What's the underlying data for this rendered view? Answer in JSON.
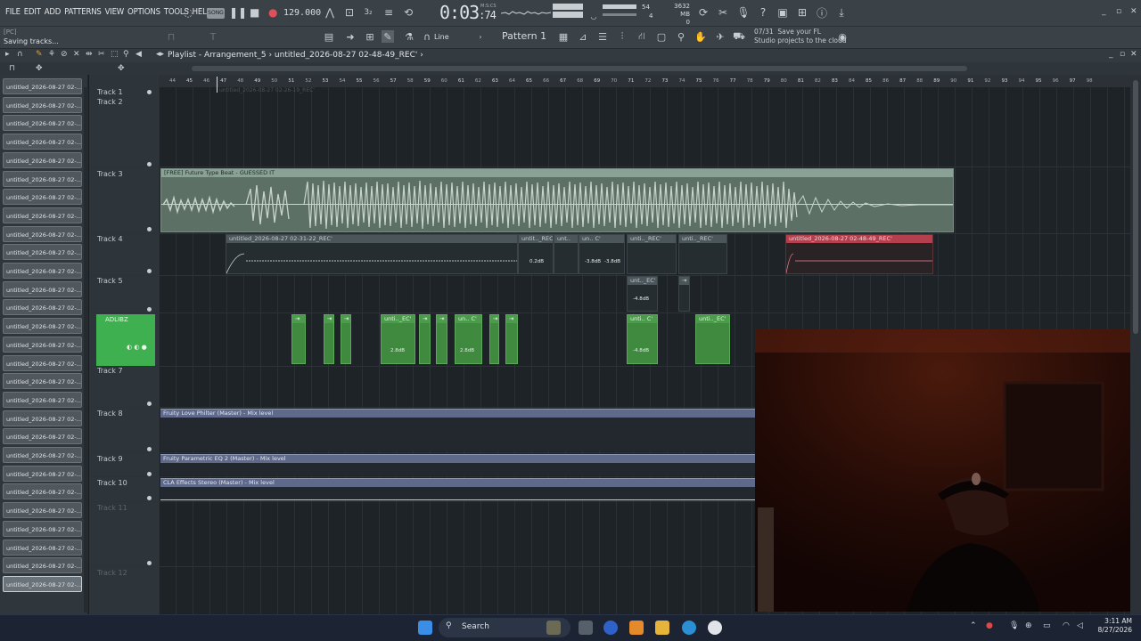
{
  "menu": [
    "FILE",
    "EDIT",
    "ADD",
    "PATTERNS",
    "VIEW",
    "OPTIONS",
    "TOOLS",
    "HELP"
  ],
  "transport": {
    "mode": "SONG",
    "tempo": "129.000",
    "time": "0:03",
    "time_sub": ":74",
    "time_format": "M:S:CS",
    "cpu_mem": "3632 MB",
    "cpu_num": "0",
    "poly_top": "54",
    "poly_bottom": "4"
  },
  "status": {
    "hint_target": "[PC]",
    "hint_text": "Saving tracks..."
  },
  "toolbar2": {
    "snap": "Line",
    "pattern": "Pattern 1"
  },
  "news": {
    "line1_prefix": "07/31",
    "line1": "Save your FL",
    "line2": "Studio projects to the cloud"
  },
  "playlist": {
    "title": "Playlist - Arrangement_5",
    "current_clip": "untitled_2026-08-27 02-48-49_REC'"
  },
  "picker_items": [
    "untitled_2026-08-27 02-...",
    "untitled_2026-08-27 02-...",
    "untitled_2026-08-27 02-...",
    "untitled_2026-08-27 02-...",
    "untitled_2026-08-27 02-...",
    "untitled_2026-08-27 02-...",
    "untitled_2026-08-27 02-...",
    "untitled_2026-08-27 02-...",
    "untitled_2026-08-27 02-...",
    "untitled_2026-08-27 02-...",
    "untitled_2026-08-27 02-...",
    "untitled_2026-08-27 02-...",
    "untitled_2026-08-27 02-...",
    "untitled_2026-08-27 02-...",
    "untitled_2026-08-27 02-...",
    "untitled_2026-08-27 02-...",
    "untitled_2026-08-27 02-...",
    "untitled_2026-08-27 02-...",
    "untitled_2026-08-27 02-...",
    "untitled_2026-08-27 02-...",
    "untitled_2026-08-27 02-...",
    "untitled_2026-08-27 02-...",
    "untitled_2026-08-27 02-...",
    "untitled_2026-08-27 02-...",
    "untitled_2026-08-27 02-...",
    "untitled_2026-08-27 02-...",
    "untitled_2026-08-27 02-...",
    "untitled_2026-08-27 02-..."
  ],
  "tracks": {
    "t1": "Track 1",
    "t2": "Track 2",
    "t3": "Track 3",
    "t4": "Track 4",
    "t5": "Track 5",
    "t6": "ADLIBZ",
    "t7": "Track 7",
    "t8": "Track 8",
    "t9": "Track 9",
    "t10": "Track 10",
    "t11": "Track 11",
    "t12": "Track 12"
  },
  "ruler": [
    "44",
    "45",
    "46",
    "47",
    "48",
    "49",
    "50",
    "51",
    "52",
    "53",
    "54",
    "55",
    "56",
    "57",
    "58",
    "59",
    "60",
    "61",
    "62",
    "63",
    "64",
    "65",
    "66",
    "67",
    "68",
    "69",
    "70",
    "71",
    "72",
    "73",
    "74",
    "75",
    "76",
    "77",
    "78",
    "79",
    "80",
    "81",
    "82",
    "83",
    "84",
    "85",
    "86",
    "87",
    "88",
    "89",
    "90",
    "91",
    "92",
    "93",
    "94",
    "95",
    "96",
    "97",
    "98"
  ],
  "clips": {
    "ghost": "untitled_2026-08-27 02-26-19_REC'",
    "beat": "[FREE] Future Type Beat - GUESSED IT",
    "rec1": "untitled_2026-08-27 02-31-22_REC'",
    "rec_a": "untit.._REC'",
    "rec_b": "unt..",
    "rec_c": "un.. C'",
    "rec_d": "unti.._REC'",
    "rec_e": "unti.._REC'",
    "rec_red": "untitled_2026-08-27 02-48-49_REC'",
    "t5_clip": "unt.._EC'",
    "adlib_a": "unti.._EC'",
    "adlib_b": "un.. C'",
    "adlib_c": "unti.. C'",
    "adlib_d": "unti.._EC'",
    "db1": "0.2dB",
    "db2": "-3.8dB",
    "db3": "-3.8dB",
    "db4": "-4.8dB",
    "db5": "2.8dB",
    "db6": "2.8dB",
    "db7": "-4.8dB",
    "auto1": "Fruity Love Philter (Master) - Mix level",
    "auto2": "Fruity Parametric EQ 2 (Master) - Mix level",
    "auto3": "CLA Effects Stereo (Master) - Mix level"
  },
  "taskbar": {
    "search": "Search",
    "time": "3:11 AM",
    "date": "8/27/2026"
  },
  "colors": {
    "audio_clip": "#5d7066",
    "adlib_green": "#3f8a3f",
    "rec_red": "#b5404d",
    "automation": "#5f6a8a"
  }
}
